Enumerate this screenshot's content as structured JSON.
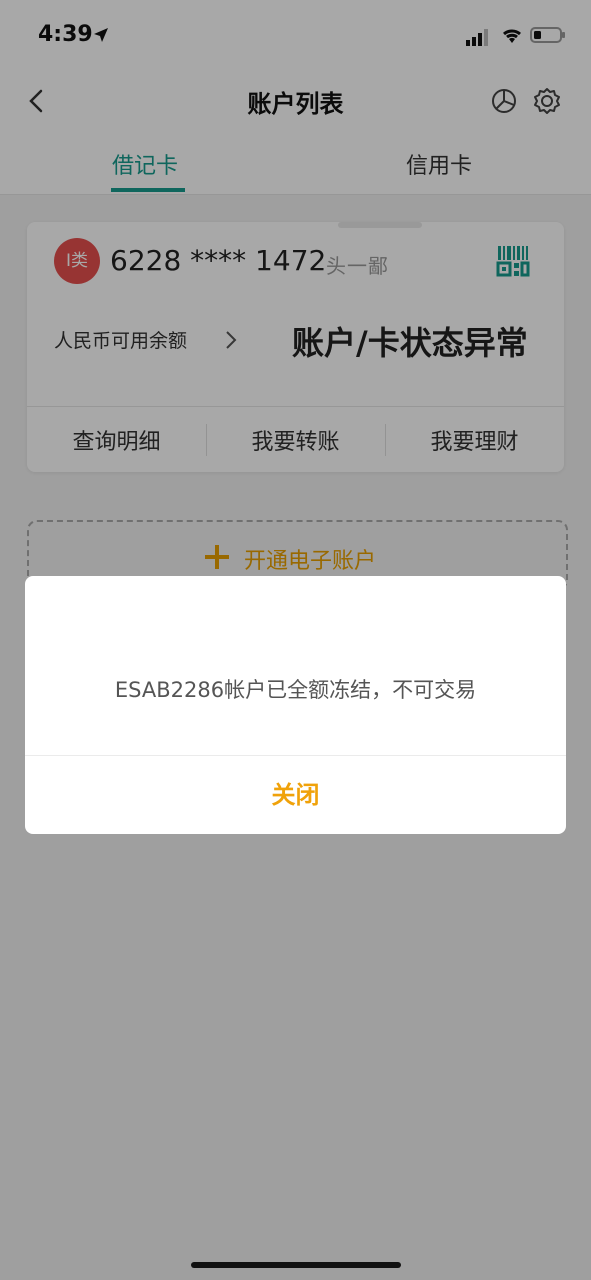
{
  "status_bar": {
    "time": "4:39"
  },
  "nav": {
    "title": "账户列表"
  },
  "tabs": [
    {
      "label": "借记卡",
      "active": true
    },
    {
      "label": "信用卡",
      "active": false
    }
  ],
  "card": {
    "badge": "I类",
    "number": "6228 **** 1472",
    "owner": "头一鄙",
    "balance_label": "人民币可用余额",
    "status": "账户/卡状态异常",
    "actions": [
      "查询明细",
      "我要转账",
      "我要理财"
    ]
  },
  "open_account": {
    "label": "开通电子账户"
  },
  "modal": {
    "message": "ESAB2286帐户已全额冻结，不可交易",
    "close_label": "关闭"
  },
  "colors": {
    "accent_green": "#179c8e",
    "accent_orange": "#f0a20a",
    "badge_red": "#e5504e"
  },
  "icons": [
    "location-arrow-icon",
    "signal-icon",
    "wifi-icon",
    "battery-icon",
    "back-icon",
    "pie-chart-icon",
    "gear-icon",
    "qr-code-icon",
    "chevron-right-icon",
    "plus-icon"
  ]
}
